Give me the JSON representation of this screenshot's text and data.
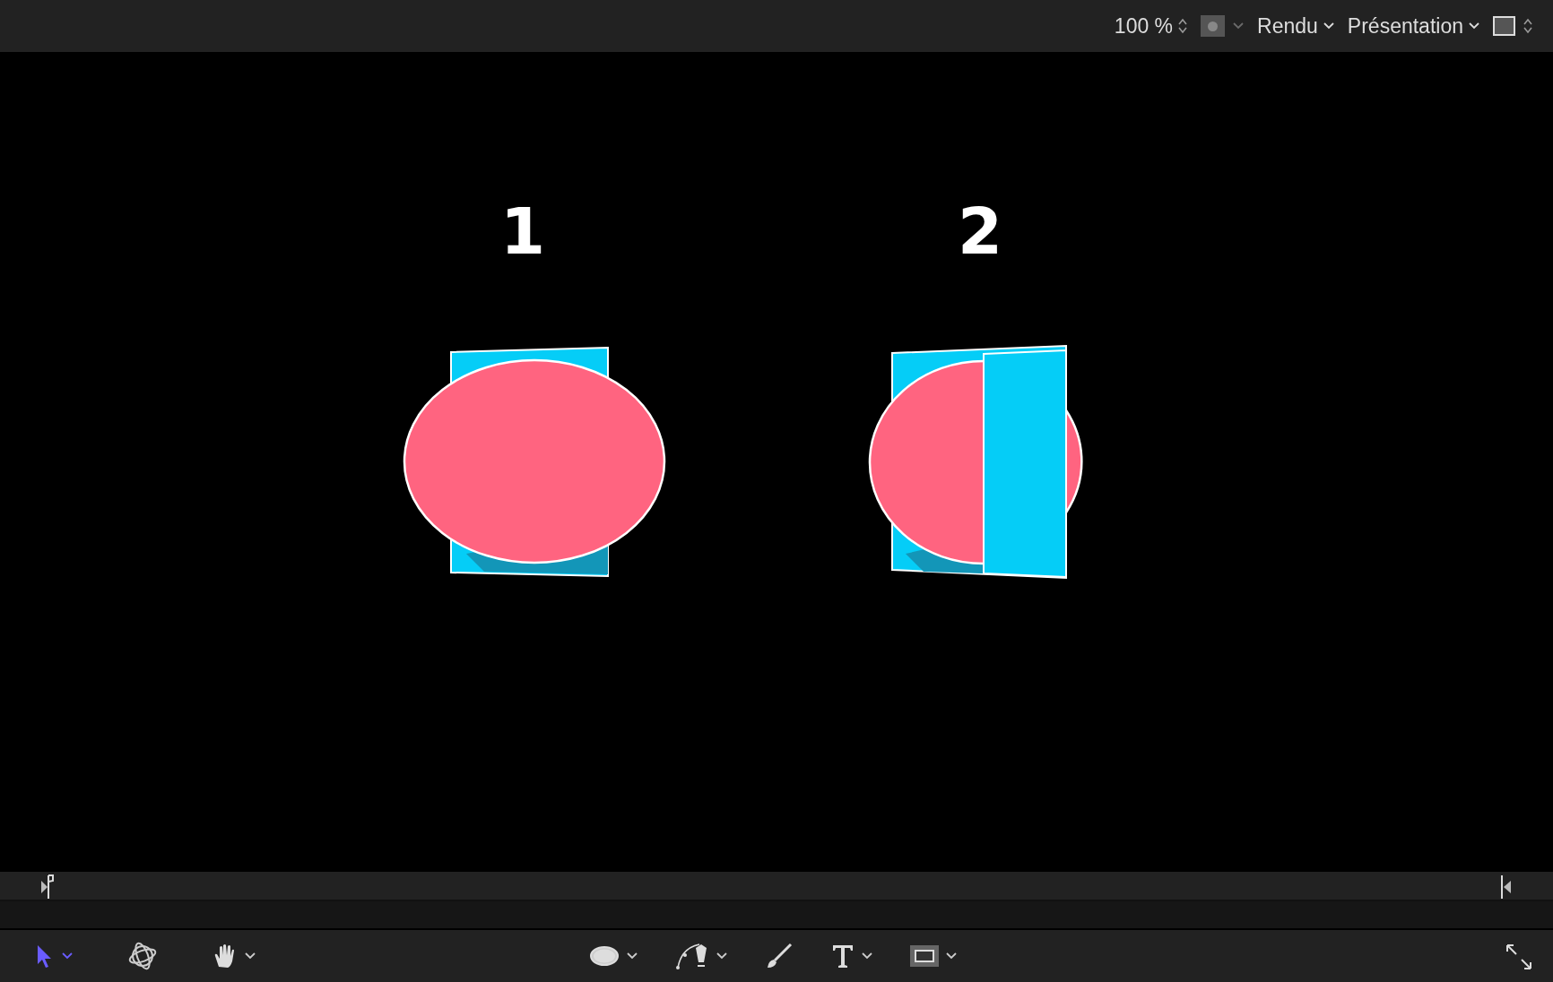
{
  "top_bar": {
    "zoom": "100 %",
    "render_menu": "Rendu",
    "view_menu": "Présentation"
  },
  "canvas": {
    "labels": [
      {
        "text": "1",
        "kind": "group_one"
      },
      {
        "text": "2",
        "kind": "group_two"
      }
    ]
  },
  "tools": [
    {
      "kind": "select",
      "selected": true
    },
    {
      "kind": "orbit",
      "selected": false
    },
    {
      "kind": "pan",
      "selected": false
    },
    {
      "kind": "shape",
      "selected": false
    },
    {
      "kind": "pen",
      "selected": false
    },
    {
      "kind": "paint",
      "selected": false
    },
    {
      "kind": "text",
      "selected": false
    },
    {
      "kind": "mask",
      "selected": false
    }
  ]
}
